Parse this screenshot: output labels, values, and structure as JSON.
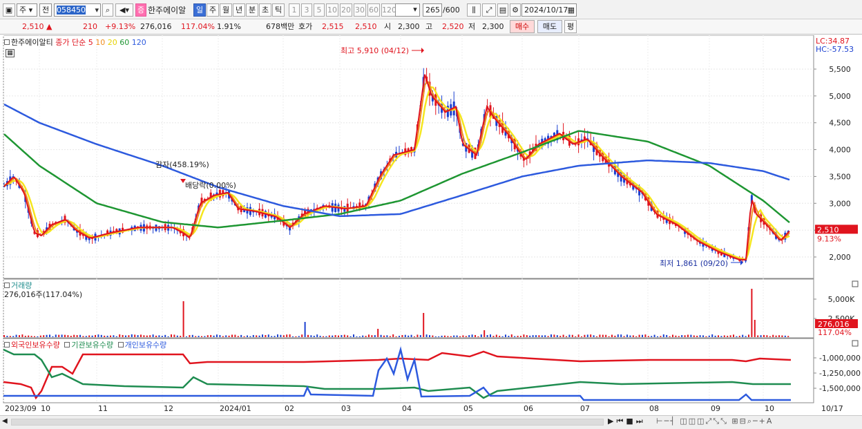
{
  "toolbar": {
    "market": "주",
    "scope": "전",
    "code": "058450",
    "stock_badge": "증",
    "stock_name": "한주에이알",
    "periods": [
      "일",
      "주",
      "월",
      "년",
      "분",
      "초",
      "틱"
    ],
    "selected_period": "일",
    "intervals": [
      "1",
      "3",
      "5",
      "10",
      "20",
      "30",
      "60",
      "120"
    ],
    "count": "265",
    "count_total": "/600",
    "date": "2024/10/17"
  },
  "quote": {
    "price": "2,510",
    "change": "210",
    "change_pct": "+9.13%",
    "volume": "276,016",
    "volume_ratio": "117.04%",
    "turnover_ratio": "1.91%",
    "amount": "678백만",
    "ask_label": "호가",
    "ask": "2,515",
    "bid": "2,510",
    "open_label": "시",
    "open": "2,300",
    "high_label": "고",
    "high": "2,520",
    "low_label": "저",
    "low": "2,300",
    "buy_button": "매수",
    "sell_button": "매도",
    "eval_button": "평"
  },
  "price_panel": {
    "stock_name": "한주에이알티",
    "ma_label": "종가 단순",
    "ma_periods": [
      "5",
      "10",
      "20",
      "60",
      "120"
    ],
    "ma_colors": [
      "#e0141e",
      "#f08c1e",
      "#f5e61e",
      "#1e9632",
      "#2d5ade"
    ],
    "lc": "LC:34.87",
    "hc": "HC:-57.53",
    "y_ticks": [
      "5,500",
      "5,000",
      "4,500",
      "4,000",
      "3,500",
      "3,000",
      "2,500",
      "2,000"
    ],
    "last_price_tag": "2,510",
    "last_pct_tag": "9.13%",
    "annotation_high": "최고 5,910 (04/12)",
    "annotation_low": "최저 1,861 (09/20)",
    "annotation_capital": "감자(458.19%)",
    "annotation_dividend": "배당락(0.00%)"
  },
  "volume_panel": {
    "title": "거래량",
    "summary": "276,016주(117.04%)",
    "y_ticks": [
      "5,000K",
      "2,500K"
    ],
    "last_tag": "276,016",
    "last_pct": "117.04%"
  },
  "holdings_panel": {
    "series": [
      "외국인보유수량",
      "기관보유수량",
      "개인보유수량"
    ],
    "colors": [
      "#e0141e",
      "#1e8c50",
      "#2d5ade"
    ],
    "y_ticks": [
      "-1,000,000",
      "-1,250,000",
      "-1,500,000"
    ]
  },
  "x_axis": {
    "labels": [
      "2023/09",
      "10",
      "11",
      "12",
      "2024/01",
      "02",
      "03",
      "04",
      "05",
      "06",
      "07",
      "08",
      "09",
      "10",
      "10/17"
    ]
  },
  "chart_data": {
    "type": "line",
    "title": "한주에이알티",
    "ylim": [
      1700,
      6000
    ],
    "series": [
      {
        "name": "종가 단순 5",
        "x": [
          "2023/09",
          "10",
          "11",
          "12",
          "2024/01",
          "02",
          "03",
          "04",
          "05",
          "06",
          "07",
          "08",
          "09",
          "10",
          "10/17"
        ],
        "values": [
          3300,
          2400,
          2350,
          2550,
          3150,
          2600,
          2900,
          4200,
          4400,
          4000,
          4250,
          3250,
          2400,
          2700,
          2510
        ]
      },
      {
        "name": "60",
        "x": [
          "2023/09",
          "10",
          "11",
          "12",
          "2024/01",
          "02",
          "03",
          "04",
          "05",
          "06",
          "07",
          "08",
          "09",
          "10",
          "10/17"
        ],
        "values": [
          4300,
          3700,
          3000,
          2650,
          2550,
          2680,
          2800,
          3050,
          3550,
          3950,
          4350,
          4150,
          3700,
          3050,
          2620
        ]
      },
      {
        "name": "120",
        "x": [
          "2023/09",
          "10",
          "11",
          "12",
          "2024/01",
          "02",
          "03",
          "04",
          "05",
          "06",
          "07",
          "08",
          "09",
          "10",
          "10/17"
        ],
        "values": [
          4850,
          4500,
          4100,
          3700,
          3300,
          2950,
          2760,
          2800,
          3150,
          3500,
          3700,
          3800,
          3750,
          3600,
          3430
        ]
      }
    ],
    "high": {
      "value": 5910,
      "date": "04/12"
    },
    "low": {
      "value": 1861,
      "date": "09/20"
    },
    "last": 2510
  }
}
